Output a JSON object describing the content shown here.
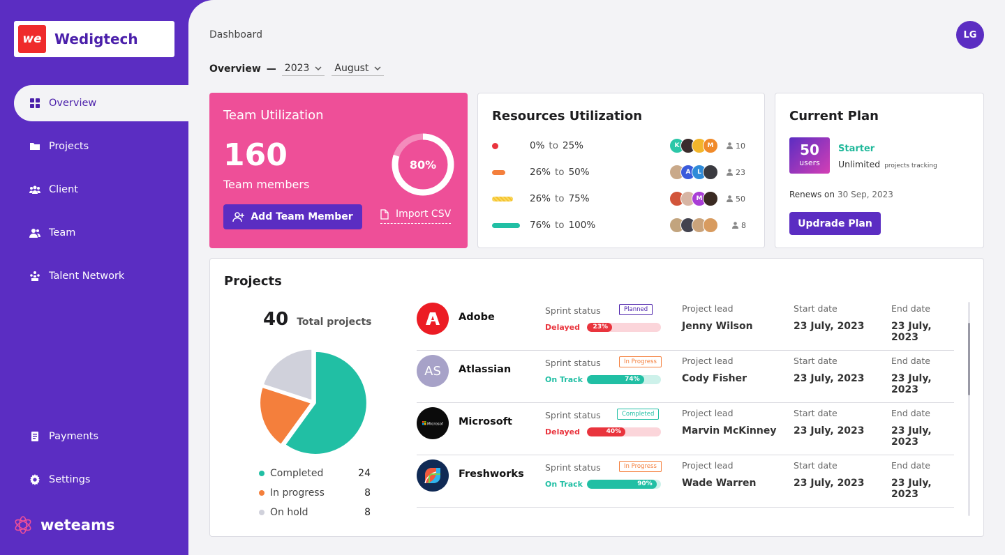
{
  "brand": {
    "logo_text": "we",
    "name": "Wedigtech"
  },
  "sidebar": {
    "items": [
      {
        "label": "Overview",
        "icon": "grid-icon"
      },
      {
        "label": "Projects",
        "icon": "folder-icon"
      },
      {
        "label": "Client",
        "icon": "users-icon"
      },
      {
        "label": "Team",
        "icon": "team-icon"
      },
      {
        "label": "Talent Network",
        "icon": "network-icon"
      }
    ],
    "bottom": [
      {
        "label": "Payments",
        "icon": "receipt-icon"
      },
      {
        "label": "Settings",
        "icon": "gear-icon"
      }
    ],
    "footer_brand": "weteams"
  },
  "header": {
    "breadcrumb": "Dashboard",
    "avatar": "LG"
  },
  "filters": {
    "label": "Overview",
    "dash": "—",
    "year": "2023",
    "month": "August"
  },
  "team_util": {
    "title": "Team Utilization",
    "count": "160",
    "count_label": "Team members",
    "percent": "80%",
    "percent_value": 0.8,
    "add_button": "Add Team Member",
    "import": "Import CSV"
  },
  "resources": {
    "title": "Resources Utilization",
    "to": "to",
    "rows": [
      {
        "from": "0%",
        "to": "25%",
        "count": "10"
      },
      {
        "from": "26%",
        "to": "50%",
        "count": "23"
      },
      {
        "from": "26%",
        "to": "75%",
        "count": "50"
      },
      {
        "from": "76%",
        "to": "100%",
        "count": "8"
      }
    ]
  },
  "plan": {
    "title": "Current Plan",
    "users": "50",
    "users_label": "users",
    "name": "Starter",
    "sub": "Unlimited",
    "sub_small": "projects tracking",
    "renew_label": "Renews on",
    "renew_date": "30 Sep, 2023",
    "button": "Updrade Plan"
  },
  "projects": {
    "title": "Projects",
    "total": "40",
    "total_label": "Total projects",
    "legend": [
      {
        "label": "Completed",
        "value": "24",
        "color": "#21bfa4"
      },
      {
        "label": "In progress",
        "value": "8",
        "color": "#f47f3c"
      },
      {
        "label": "On hold",
        "value": "8",
        "color": "#d0d1db"
      }
    ],
    "col_sprint": "Sprint status",
    "col_lead": "Project lead",
    "col_start": "Start date",
    "col_end": "End date",
    "rows": [
      {
        "name": "Adobe",
        "tag": "Planned",
        "status": "Delayed",
        "progress": "23%",
        "lead": "Jenny Wilson",
        "start": "23 July, 2023",
        "end": "23 July, 2023"
      },
      {
        "name": "Atlassian",
        "logo": "AS",
        "tag": "In Progress",
        "status": "On Track",
        "progress": "74%",
        "lead": "Cody Fisher",
        "start": "23 July, 2023",
        "end": "23 July, 2023"
      },
      {
        "name": "Microsoft",
        "tag": "Completed",
        "status": "Delayed",
        "progress": "40%",
        "lead": "Marvin McKinney",
        "start": "23 July, 2023",
        "end": "23 July, 2023"
      },
      {
        "name": "Freshworks",
        "tag": "In Progress",
        "status": "On Track",
        "progress": "90%",
        "lead": "Wade Warren",
        "start": "23 July, 2023",
        "end": "23 July, 2023"
      }
    ]
  }
}
